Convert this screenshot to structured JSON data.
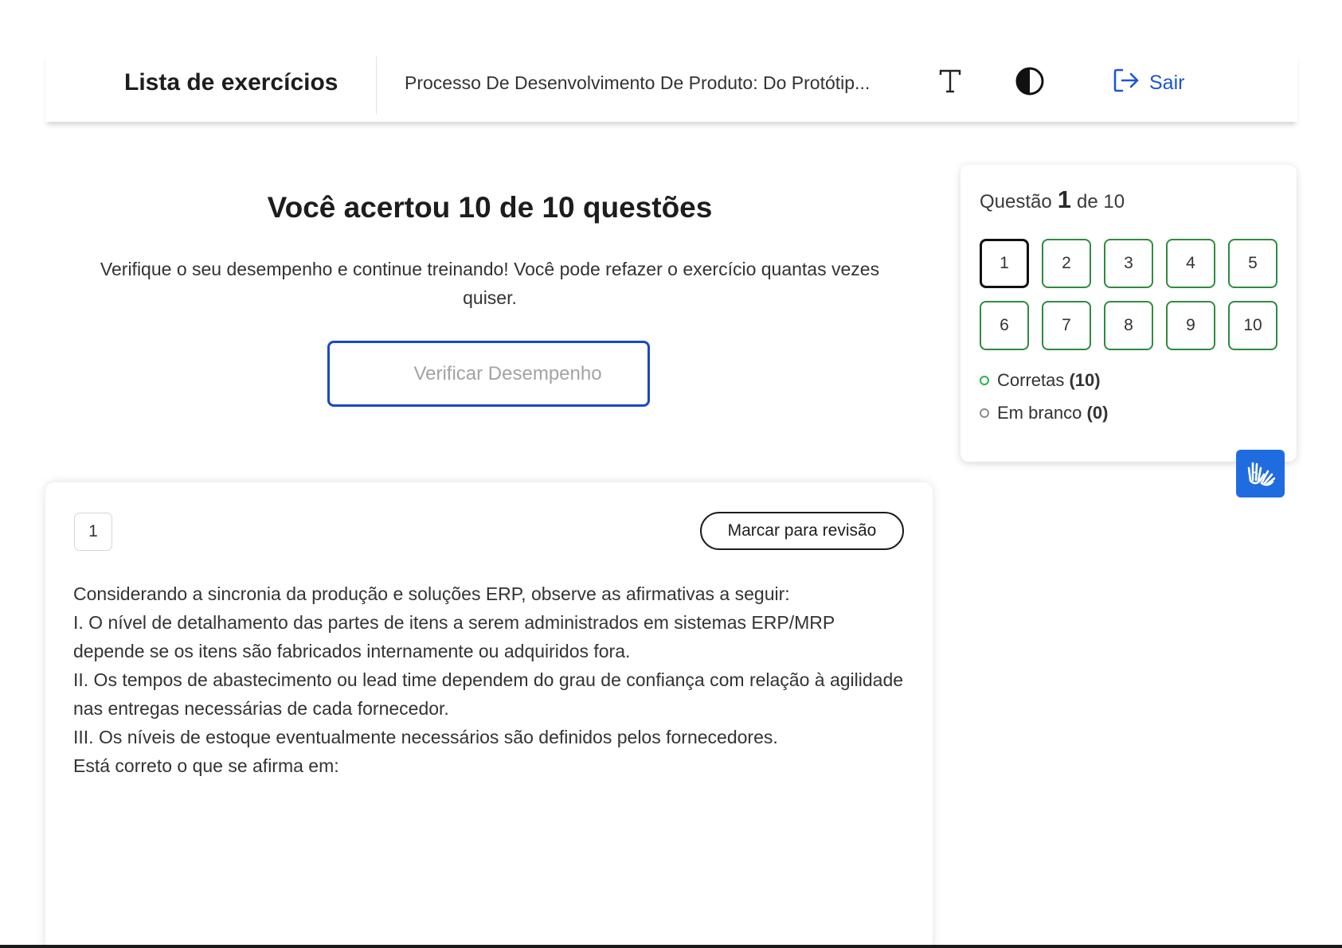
{
  "header": {
    "title": "Lista de exercícios",
    "course_title": "Processo De Desenvolvimento De Produto: Do Protótip...",
    "font_size_icon": "text-size-icon",
    "contrast_icon": "contrast-icon",
    "logout_icon": "logout-icon",
    "logout_label": "Sair"
  },
  "result": {
    "title": "Você acertou 10 de 10 questões",
    "description": "Verifique o seu desempenho e continue treinando! Você pode refazer o exercício quantas vezes quiser.",
    "verify_button": "Verificar Desempenho"
  },
  "question": {
    "number": "1",
    "review_button": "Marcar para revisão",
    "lines": [
      "Considerando a sincronia da produção e soluções ERP, observe as afirmativas a seguir:",
      "I. O nível de detalhamento das partes de itens a serem administrados em sistemas ERP/MRP depende se os itens são fabricados internamente ou adquiridos fora.",
      "II. Os tempos de abastecimento ou lead time dependem do grau de confiança com relação à agilidade nas entregas necessárias de cada fornecedor.",
      "III. Os níveis de estoque eventualmente necessários são definidos pelos fornecedores.",
      "Está correto o que se afirma em:"
    ]
  },
  "navigator": {
    "label_prefix": "Questão",
    "current": "1",
    "label_suffix": "de 10",
    "questions": [
      "1",
      "2",
      "3",
      "4",
      "5",
      "6",
      "7",
      "8",
      "9",
      "10"
    ],
    "correct_label": "Corretas",
    "correct_count": "(10)",
    "blank_label": "Em branco",
    "blank_count": "(0)"
  },
  "accessibility": {
    "libras_icon": "sign-language-hands-icon"
  },
  "colors": {
    "accent_blue": "#1a56d6",
    "correct_green": "#2e8b3e",
    "libras_blue": "#1f6ce0"
  }
}
